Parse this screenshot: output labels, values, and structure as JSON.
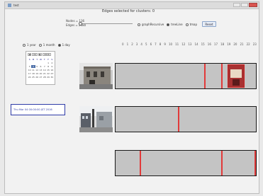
{
  "window": {
    "title": "test"
  },
  "header": {
    "title": "Edges selected for clusters: 0",
    "nodes_label": "Nodes = 136",
    "edges_label": "Edges = 2380"
  },
  "slider": {
    "value": 0
  },
  "options": {
    "layout": [
      {
        "label": "graphRecursive",
        "selected": false
      },
      {
        "label": "treeLine",
        "selected": true
      },
      {
        "label": "tmap",
        "selected": false
      }
    ],
    "reset_label": "Reset"
  },
  "range": [
    {
      "label": "1 year",
      "selected": false
    },
    {
      "label": "1 month",
      "selected": false
    },
    {
      "label": "1 day",
      "selected": true
    }
  ],
  "scale": [
    "0",
    "1",
    "2",
    "3",
    "4",
    "5",
    "6",
    "7",
    "8",
    "9",
    "10",
    "11",
    "12",
    "13",
    "14",
    "15",
    "16",
    "17",
    "18",
    "19",
    "20",
    "21",
    "22",
    "23"
  ],
  "calendar": {
    "month": "04",
    "year": "2016",
    "day_headers": [
      "S",
      "M",
      "T",
      "W",
      "T",
      "F",
      "S"
    ],
    "days": [
      "",
      "",
      "",
      "",
      "",
      "1",
      "2",
      "3",
      "4",
      "5",
      "6",
      "7",
      "8",
      "9",
      "10",
      "11",
      "12",
      "13",
      "14",
      "15",
      "16",
      "17",
      "18",
      "19",
      "20",
      "21",
      "22",
      "23",
      "24",
      "25",
      "26",
      "27",
      "28",
      "29",
      "30"
    ],
    "selected_day": "4"
  },
  "selected_date": "Thu Mar 04 00:00:00 JST 2016",
  "rows": [
    {
      "thumb": "building-photo",
      "marks_hour": [
        15.2,
        18.0
      ],
      "overlay_hour": 19.1
    },
    {
      "thumb": "street-photo",
      "marks_hour": [
        10.7
      ]
    },
    {
      "thumb": "",
      "marks_hour": [
        4.1,
        18.0,
        23.8,
        24.4
      ]
    }
  ],
  "colors": {
    "accent": "#2f3ca8",
    "mark": "#e23a3a"
  }
}
